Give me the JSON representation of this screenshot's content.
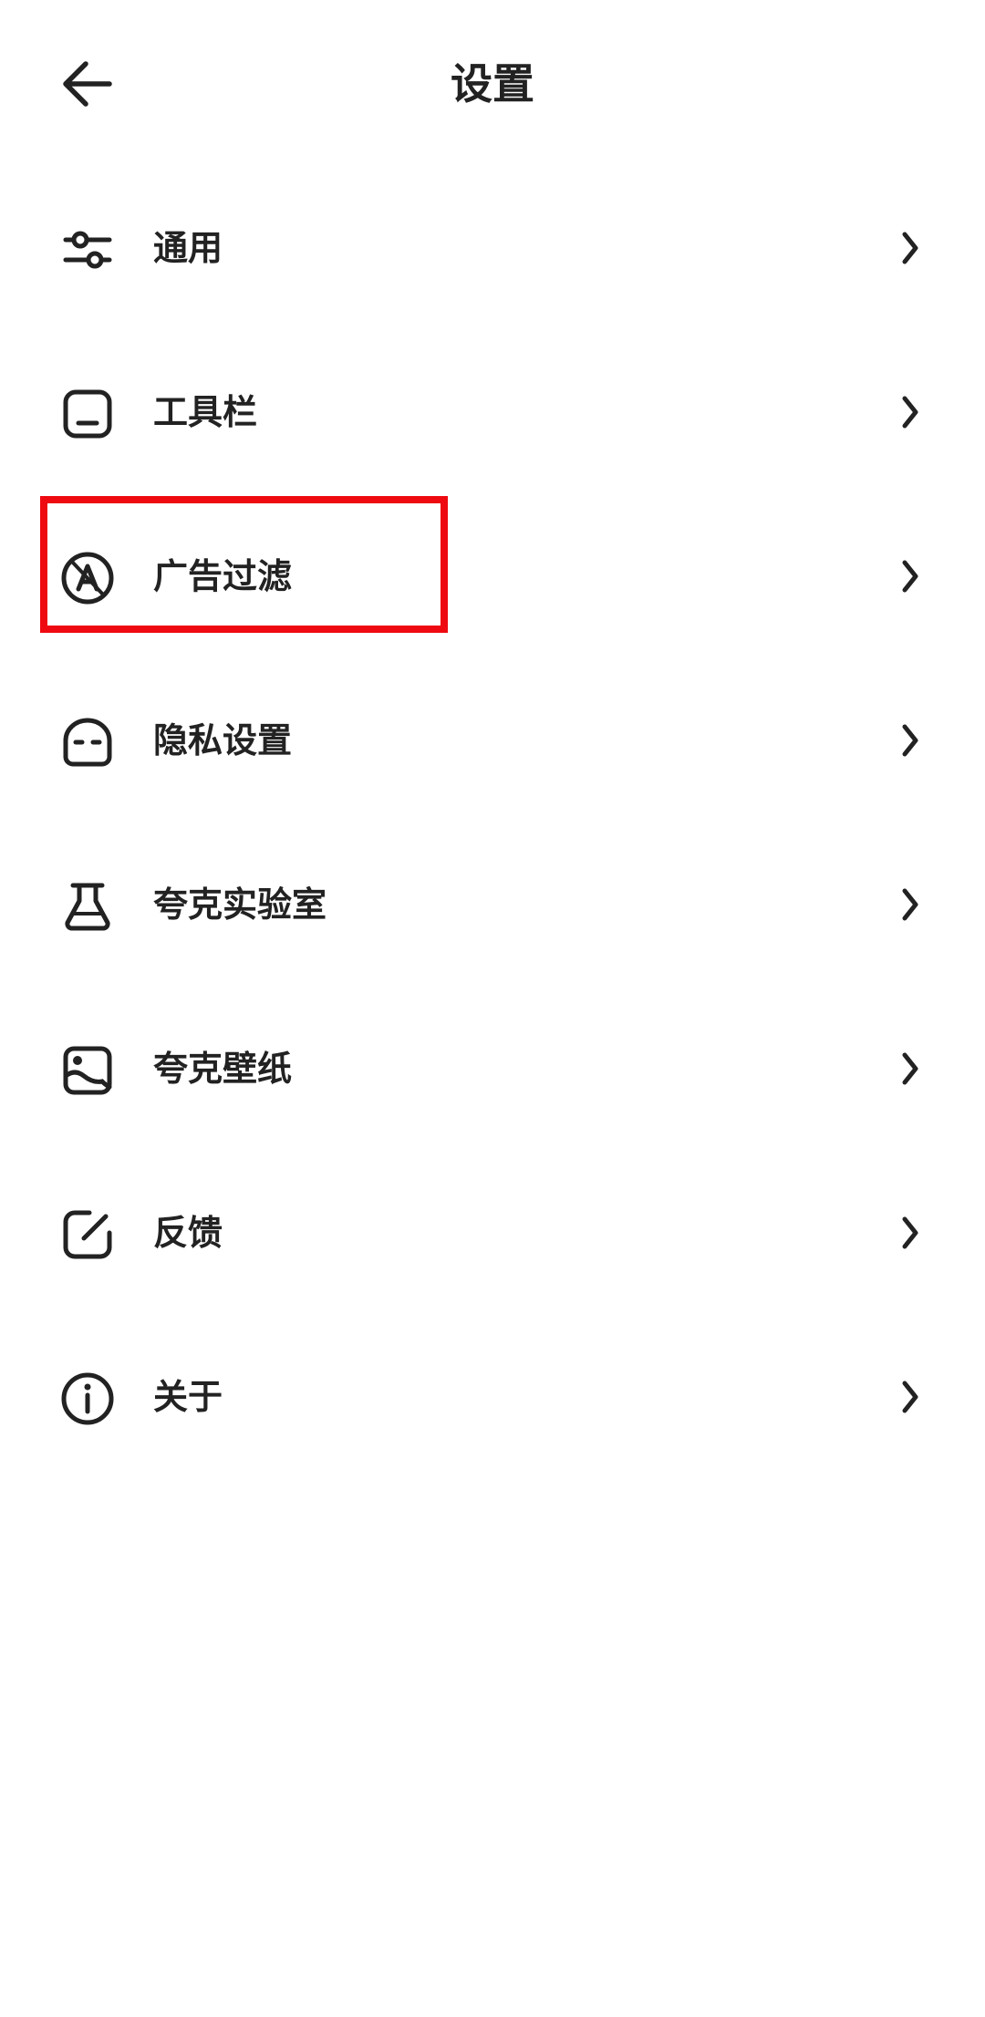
{
  "header": {
    "title": "设置",
    "back_icon": "arrow-left-icon"
  },
  "menu": [
    {
      "id": "general",
      "label": "通用",
      "icon": "sliders-icon"
    },
    {
      "id": "toolbar",
      "label": "工具栏",
      "icon": "toolbar-icon"
    },
    {
      "id": "ad-filter",
      "label": "广告过滤",
      "icon": "ad-block-icon"
    },
    {
      "id": "privacy",
      "label": "隐私设置",
      "icon": "mask-icon"
    },
    {
      "id": "lab",
      "label": "夸克实验室",
      "icon": "flask-icon"
    },
    {
      "id": "wallpaper",
      "label": "夸克壁纸",
      "icon": "image-icon"
    },
    {
      "id": "feedback",
      "label": "反馈",
      "icon": "edit-icon"
    },
    {
      "id": "about",
      "label": "关于",
      "icon": "info-icon"
    }
  ],
  "chevron_icon": "chevron-right-icon",
  "colors": {
    "text": "#222222",
    "highlight": "#ee0a10",
    "background": "#ffffff"
  }
}
